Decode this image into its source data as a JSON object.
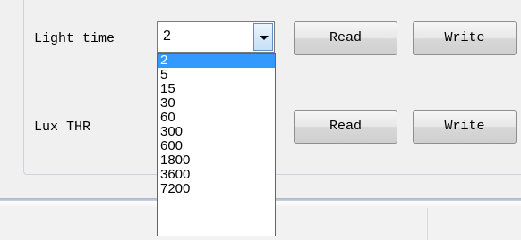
{
  "light_time": {
    "label": "Light time",
    "selected_value": "2",
    "read_label": "Read",
    "write_label": "Write"
  },
  "lux_thr": {
    "label": "Lux THR",
    "read_label": "Read",
    "write_label": "Write"
  },
  "dropdown": {
    "options": [
      "2",
      "5",
      "15",
      "30",
      "60",
      "300",
      "600",
      "1800",
      "3600",
      "7200"
    ],
    "highlighted": "2"
  },
  "icons": {
    "combo_button": "chevron-down-icon"
  },
  "colors": {
    "selection": "#3399ff",
    "window_bg": "#f0f0f0"
  }
}
